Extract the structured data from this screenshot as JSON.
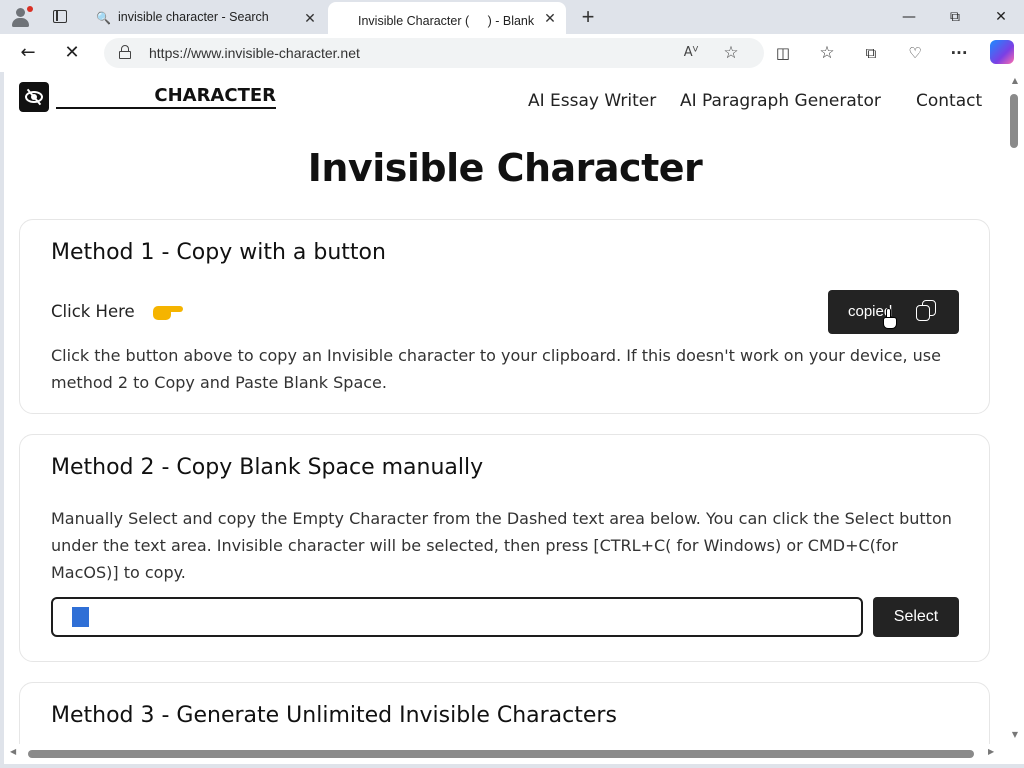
{
  "browser": {
    "tabs": [
      {
        "title": "invisible character - Search",
        "active": false
      },
      {
        "title": "Invisible Character ( ㅤ ) - Blank Space",
        "active": true
      }
    ],
    "url": "https://www.invisible-character.net",
    "window_controls": [
      "minimize",
      "restore",
      "close"
    ],
    "icons": {
      "back": "arrow-left-icon",
      "refresh": "stop-icon",
      "read_aloud": "read-aloud-icon",
      "favorite": "star-icon",
      "split": "split-screen-icon",
      "favorites": "favorites-icon",
      "collections": "collections-icon",
      "browser_essentials": "heart-pulse-icon",
      "more": "ellipsis-icon",
      "copilot": "copilot-icon"
    },
    "glyphs": {
      "search": "🔍",
      "close": "✕",
      "new_tab": "+",
      "minimize": "—",
      "restore": "⧉",
      "back": "←",
      "stop": "✕",
      "read_aloud": "Aⱽ",
      "star": "☆",
      "split": "◫",
      "favorites": "☆",
      "collections": "⧉",
      "heart": "♡",
      "more": "···",
      "up": "▲",
      "down": "▼",
      "left": "◀",
      "right": "▶"
    }
  },
  "site": {
    "brand": "CHARACTER",
    "nav": [
      "AI Essay Writer",
      "AI Paragraph Generator",
      "Contact"
    ],
    "title": "Invisible Character",
    "method1": {
      "heading": "Method 1 - Copy with a button",
      "click_here": "Click Here",
      "button_label": "copied",
      "description": "Click the button above to copy an Invisible character to your clipboard. If this doesn't work on your device, use method 2 to Copy and Paste Blank Space."
    },
    "method2": {
      "heading": "Method 2 - Copy Blank Space manually",
      "description": "Manually Select and copy the Empty Character from the Dashed text area below. You can click the Select button under the text area. Invisible character will be selected, then press [CTRL+C( for Windows) or CMD+C(for MacOS)] to copy.",
      "field_value": "ㅤ",
      "select_label": "Select"
    },
    "method3": {
      "heading": "Method 3 - Generate Unlimited Invisible Characters"
    }
  },
  "colors": {
    "chrome_bg": "#dfe3ea",
    "button_dark": "#232323",
    "selection": "#2f6fd6",
    "pointing_hand": "#f5b400"
  }
}
